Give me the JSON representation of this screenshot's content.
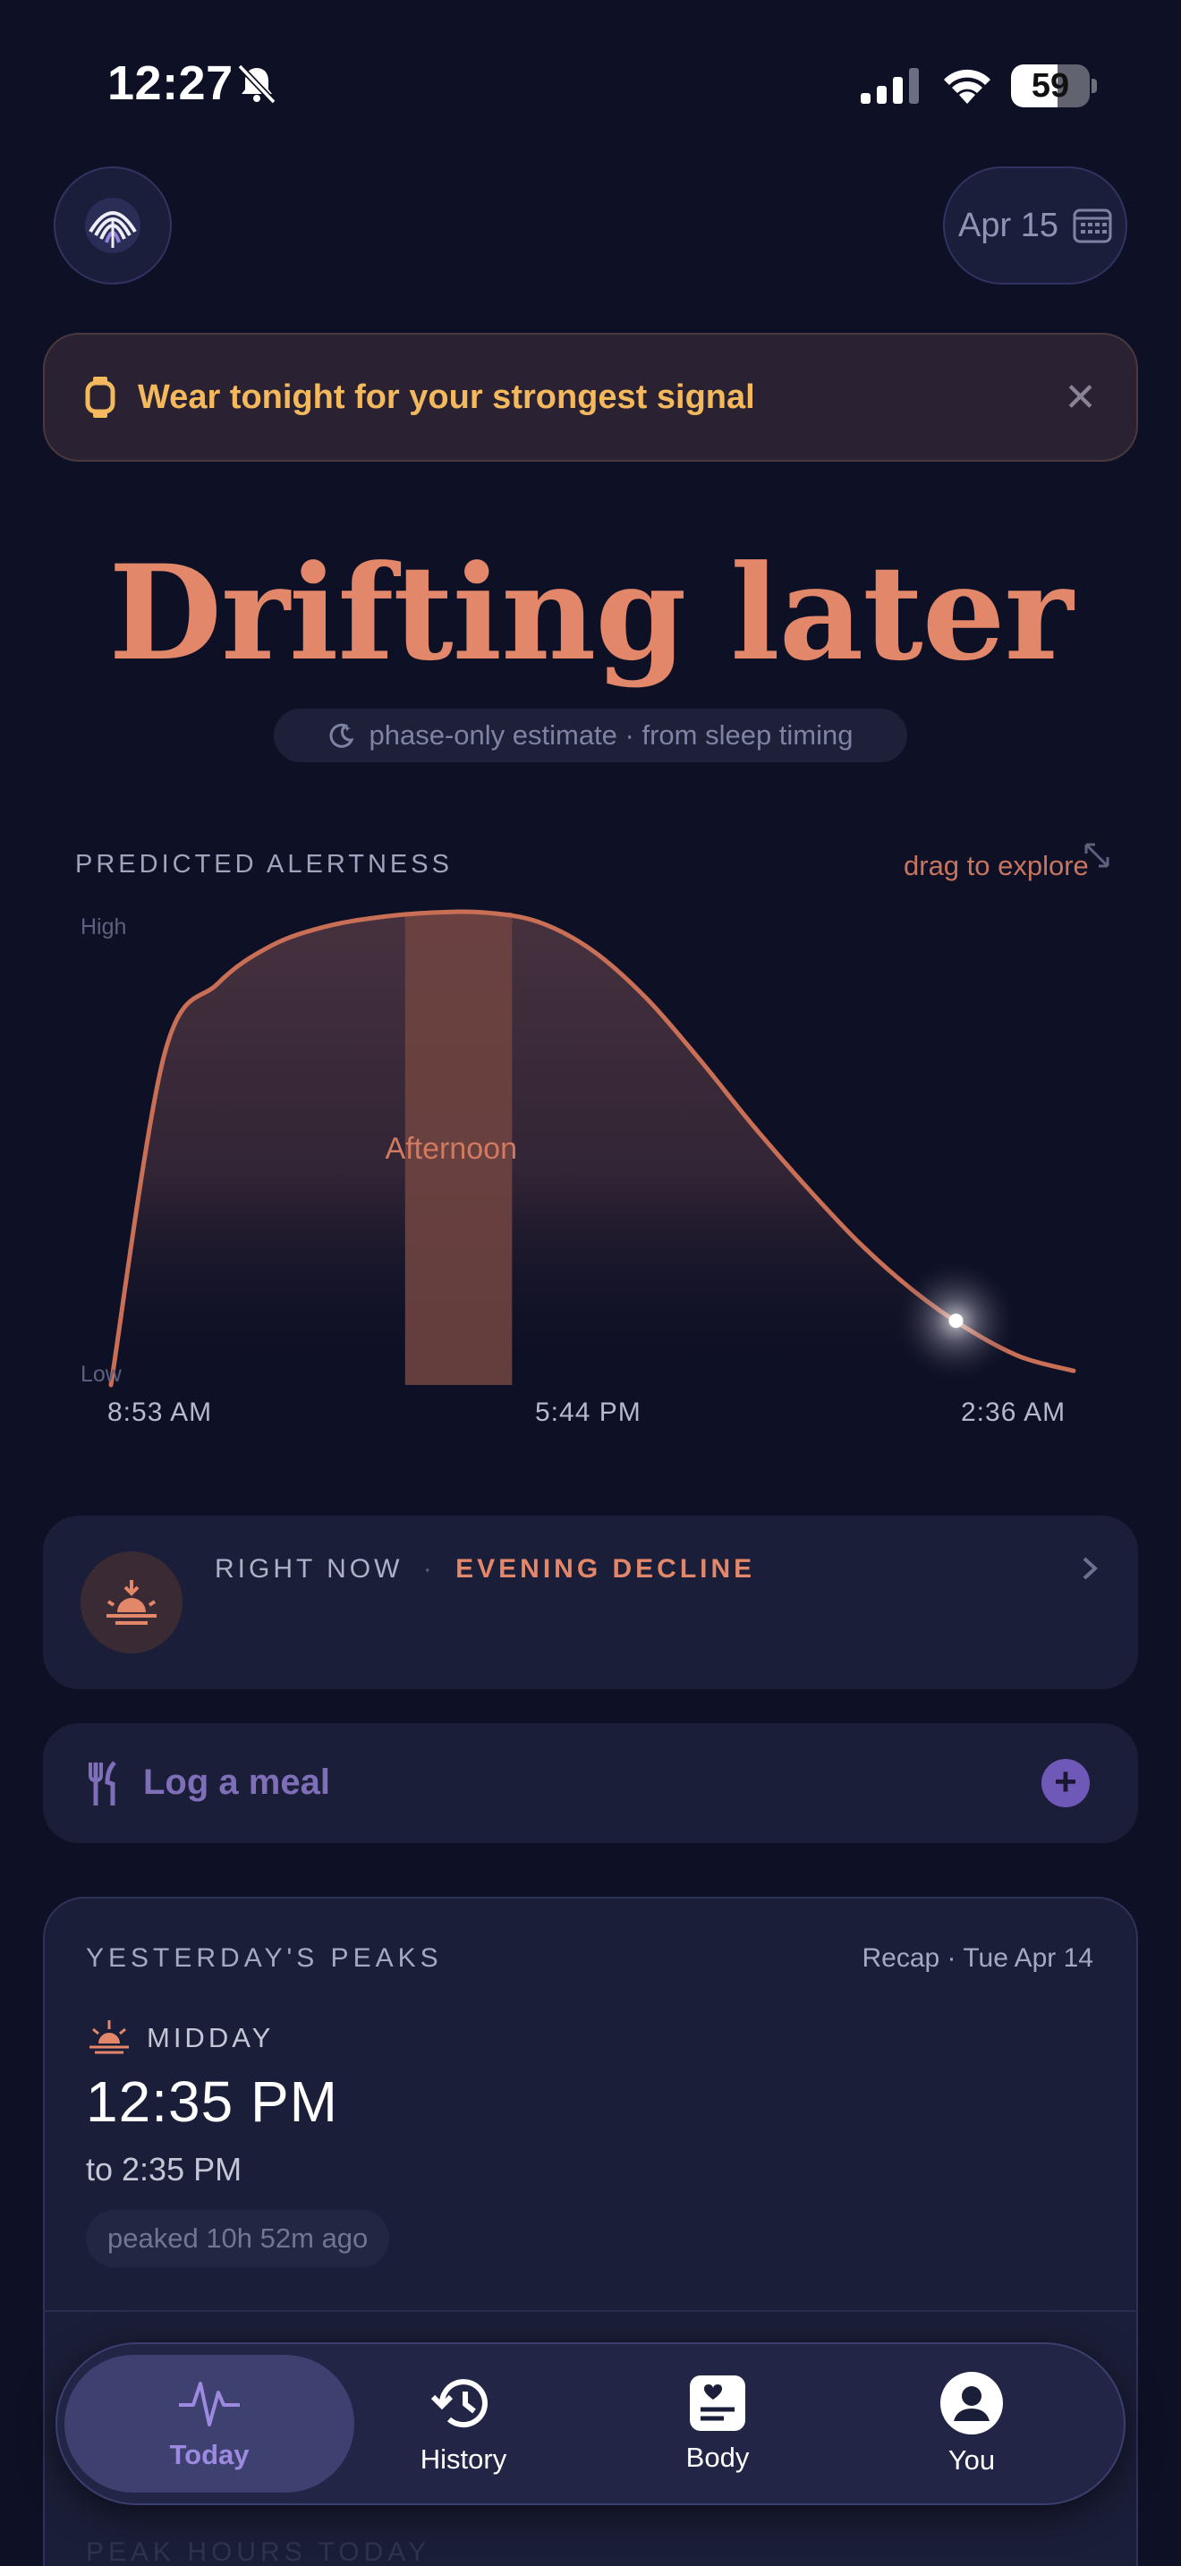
{
  "status_bar": {
    "time": "12:27",
    "battery": "59",
    "battery_level": 0.59
  },
  "header": {
    "date_label": "Apr 15"
  },
  "banner": {
    "text": "Wear tonight for your strongest signal",
    "close": "✕"
  },
  "headline": {
    "title": "Drifting later",
    "subtitle": "phase-only estimate · from sleep timing"
  },
  "chart": {
    "section_label": "PREDICTED ALERTNESS",
    "drag_hint": "drag to explore",
    "high_label": "High",
    "low_label": "Low",
    "band_label": "Afternoon",
    "ticks": [
      "8:53 AM",
      "5:44 PM",
      "2:36 AM"
    ]
  },
  "chart_data": {
    "type": "area",
    "title": "PREDICTED ALERTNESS",
    "xlabel": "",
    "ylabel": "",
    "x_labels": [
      "8:53 AM",
      "5:44 PM",
      "2:36 AM"
    ],
    "x_hours": [
      0,
      1,
      2,
      3,
      4,
      5,
      6,
      7,
      8,
      9,
      10,
      11,
      12,
      13,
      14,
      15,
      16,
      17,
      18
    ],
    "y": [
      0.0,
      0.7,
      0.85,
      0.93,
      0.97,
      0.99,
      1.0,
      1.0,
      0.98,
      0.92,
      0.82,
      0.69,
      0.55,
      0.42,
      0.3,
      0.2,
      0.12,
      0.06,
      0.03
    ],
    "ylim": [
      0,
      1
    ],
    "y_axis_labels": [
      "Low",
      "High"
    ],
    "band": {
      "label": "Afternoon",
      "start_hour": 5.5,
      "end_hour": 7.5
    },
    "current_hour": 15.8,
    "colors": {
      "line": "#c96f56",
      "band": "#6e4440",
      "marker": "#ffffff"
    }
  },
  "right_now": {
    "label": "RIGHT NOW",
    "separator": "·",
    "phase": "EVENING DECLINE"
  },
  "meal": {
    "label": "Log a meal",
    "plus": "+"
  },
  "peaks": {
    "title": "YESTERDAY'S PEAKS",
    "recap": "Recap · Tue Apr 14",
    "period": "MIDDAY",
    "time": "12:35 PM",
    "to": "to 2:35 PM",
    "ago": "peaked 10h 52m ago",
    "next_section": "PEAK HOURS TODAY"
  },
  "tabs": [
    {
      "label": "Today",
      "icon": "pulse-icon",
      "active": true
    },
    {
      "label": "History",
      "icon": "history-icon",
      "active": false
    },
    {
      "label": "Body",
      "icon": "body-icon",
      "active": false
    },
    {
      "label": "You",
      "icon": "person-icon",
      "active": false
    }
  ],
  "colors": {
    "accent": "#e3876a",
    "warning": "#f3b95c",
    "purple": "#9c8ae0",
    "background": "#0e1025"
  }
}
